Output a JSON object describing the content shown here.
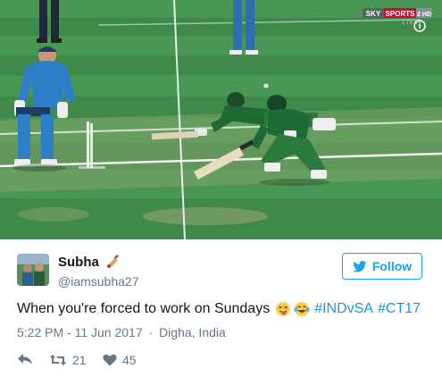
{
  "broadcast": {
    "channel": "SKY SPORTS",
    "badge": "2 HD",
    "live": "LIVE"
  },
  "tweet": {
    "author_name": "Subha",
    "author_handle": "@iamsubha27",
    "name_emoji": "cricket-bat-icon",
    "follow_label": "Follow",
    "text": "When you're forced to work on Sundays",
    "text_emojis": [
      "squinting-tongue-face-icon",
      "tears-of-joy-face-icon"
    ],
    "hashtags": [
      "#INDvSA",
      "#CT17"
    ],
    "timestamp": "5:22 PM - 11 Jun 2017",
    "separator": "·",
    "location": "Digha, India",
    "retweet_count": "21",
    "like_count": "45"
  },
  "colors": {
    "accent": "#1da1f2",
    "hashtag": "#1b95e0",
    "secondary_text": "#657786",
    "primary_text": "#14171a"
  }
}
